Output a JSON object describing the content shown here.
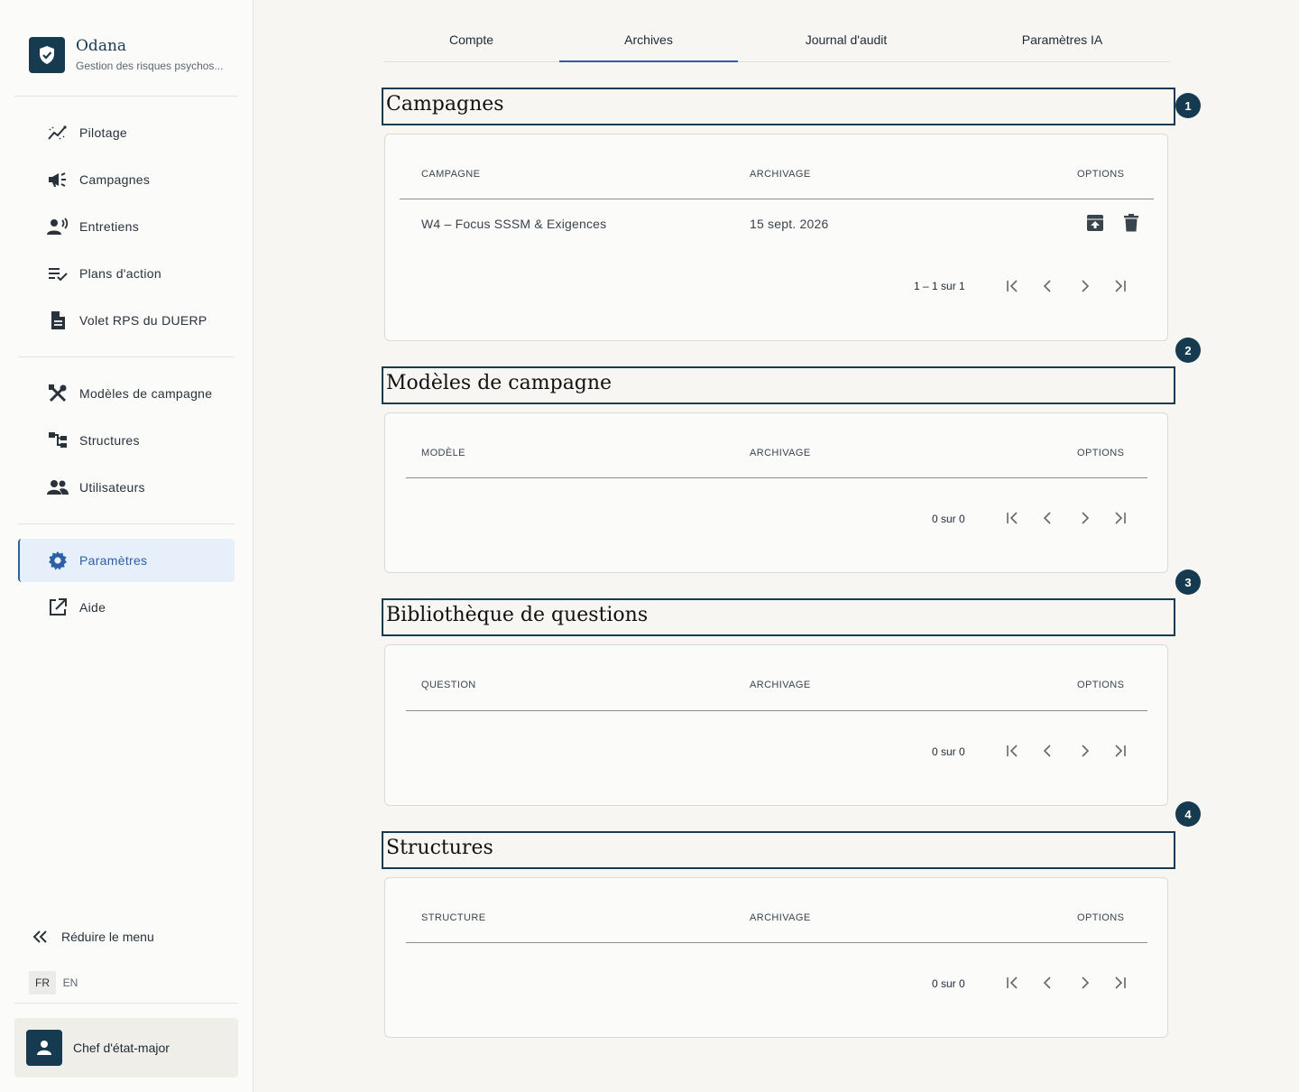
{
  "brand": {
    "name": "Odana",
    "subtitle": "Gestion des risques psychos..."
  },
  "nav": {
    "primary": [
      {
        "label": "Pilotage",
        "icon": "chart-line-icon"
      },
      {
        "label": "Campagnes",
        "icon": "megaphone-icon"
      },
      {
        "label": "Entretiens",
        "icon": "voice-user-icon"
      },
      {
        "label": "Plans d'action",
        "icon": "checklist-icon"
      },
      {
        "label": "Volet RPS du DUERP",
        "icon": "document-icon"
      }
    ],
    "secondary": [
      {
        "label": "Modèles de campagne",
        "icon": "tools-icon"
      },
      {
        "label": "Structures",
        "icon": "hierarchy-icon"
      },
      {
        "label": "Utilisateurs",
        "icon": "users-icon"
      }
    ],
    "tertiary": [
      {
        "label": "Paramètres",
        "icon": "gear-icon",
        "active": true
      },
      {
        "label": "Aide",
        "icon": "external-link-icon"
      }
    ],
    "collapse_label": "Réduire le menu",
    "languages": [
      "FR",
      "EN"
    ],
    "active_language": "FR"
  },
  "user": {
    "role": "Chef d'état-major"
  },
  "tabs": [
    {
      "label": "Compte"
    },
    {
      "label": "Archives",
      "active": true
    },
    {
      "label": "Journal d'audit"
    },
    {
      "label": "Paramètres IA"
    }
  ],
  "sections": [
    {
      "badge": "1",
      "title": "Campagnes",
      "columns": [
        "CAMPAGNE",
        "ARCHIVAGE",
        "OPTIONS"
      ],
      "rows": [
        {
          "name": "W4 – Focus SSSM & Exigences",
          "date": "15 sept. 2026"
        }
      ],
      "pager": "1 – 1 sur 1"
    },
    {
      "badge": "2",
      "title": "Modèles de campagne",
      "columns": [
        "MODÈLE",
        "ARCHIVAGE",
        "OPTIONS"
      ],
      "rows": [],
      "pager": "0 sur 0"
    },
    {
      "badge": "3",
      "title": "Bibliothèque de questions",
      "columns": [
        "QUESTION",
        "ARCHIVAGE",
        "OPTIONS"
      ],
      "rows": [],
      "pager": "0 sur 0"
    },
    {
      "badge": "4",
      "title": "Structures",
      "columns": [
        "STRUCTURE",
        "ARCHIVAGE",
        "OPTIONS"
      ],
      "rows": [],
      "pager": "0 sur 0"
    }
  ],
  "colors": {
    "primary": "#163a4f",
    "accent": "#2d5fa6",
    "active_bg": "#e7effa"
  }
}
